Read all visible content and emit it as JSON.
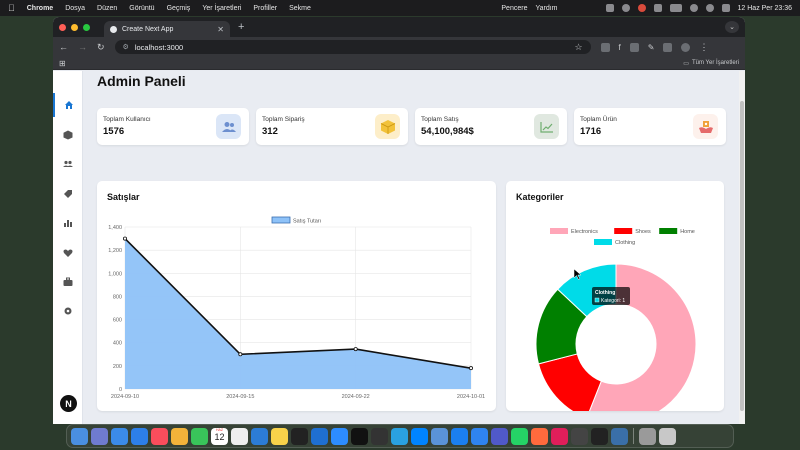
{
  "menubar": {
    "app": "Chrome",
    "items": [
      "Dosya",
      "Düzen",
      "Görüntü",
      "Geçmiş",
      "Yer İşaretleri",
      "Profiller",
      "Sekme"
    ],
    "right_items": [
      "Pencere",
      "Yardım"
    ],
    "clock": "12 Haz Per  23:36"
  },
  "browser": {
    "tab_title": "Create Next App",
    "url": "localhost:3000",
    "bookmarks_all": "Tüm Yer İşaretleri"
  },
  "page": {
    "title": "Admin Paneli",
    "sidebar": [
      "home-icon",
      "box-icon",
      "users-icon",
      "tag-icon",
      "bar-chart-icon",
      "heart-icon",
      "briefcase-icon",
      "settings-icon"
    ],
    "stats": [
      {
        "label": "Toplam Kullanıcı",
        "value": "1576",
        "icon": "users-icon",
        "color": "#dbe6f7"
      },
      {
        "label": "Toplam Sipariş",
        "value": "312",
        "icon": "box-icon",
        "color": "#fdeec9"
      },
      {
        "label": "Toplam Satış",
        "value": "54,100,984$",
        "icon": "chart-icon",
        "color": "#e0e8e0"
      },
      {
        "label": "Toplam Ürün",
        "value": "1716",
        "icon": "product-icon",
        "color": "#fdf1ec"
      }
    ],
    "sales_title": "Satışlar",
    "categories_title": "Kategoriler"
  },
  "chart_data": [
    {
      "type": "area",
      "x": [
        "2024-09-10",
        "2024-09-15",
        "2024-09-22",
        "2024-10-01"
      ],
      "series": [
        {
          "name": "Satış Tutarı",
          "values": [
            1300,
            300,
            345,
            180
          ],
          "color": "#8ec2f8",
          "line": "#111111"
        }
      ],
      "ylim": [
        0,
        1400
      ],
      "yticks": [
        "0",
        "200",
        "400",
        "600",
        "800",
        "1,000",
        "1,200",
        "1,400"
      ],
      "grid": true,
      "legend": "top"
    },
    {
      "type": "pie",
      "labels": [
        "Electronics",
        "Shoes",
        "Home",
        "Clothing"
      ],
      "values": [
        56,
        15,
        16,
        13
      ],
      "colors": [
        "#ffa6b8",
        "#ff0000",
        "#008000",
        "#00dbe8"
      ],
      "legend": "top",
      "tooltip": {
        "title": "Clothing",
        "body": "Kategori: 1"
      }
    }
  ],
  "dock": {
    "apps": [
      "finder-icon",
      "launchpad-icon",
      "safari-icon",
      "mail-icon",
      "music-icon",
      "photos-icon",
      "facetime-icon",
      "calendar-icon",
      "chrome-icon",
      "vscode-icon",
      "notes-icon",
      "terminal-icon",
      "outlook-icon",
      "zoom-icon",
      "github-icon",
      "terminal2-icon",
      "telegram-icon",
      "messenger-icon",
      "preview-icon",
      "xcode-icon",
      "appstore-icon",
      "teams-icon",
      "whatsapp-icon",
      "pen-icon",
      "slack-icon",
      "focus-icon",
      "capcut-icon",
      "screens-icon",
      "calculator-icon",
      "trash-icon"
    ],
    "calendar_month": "HAZ",
    "calendar_day": "12"
  }
}
